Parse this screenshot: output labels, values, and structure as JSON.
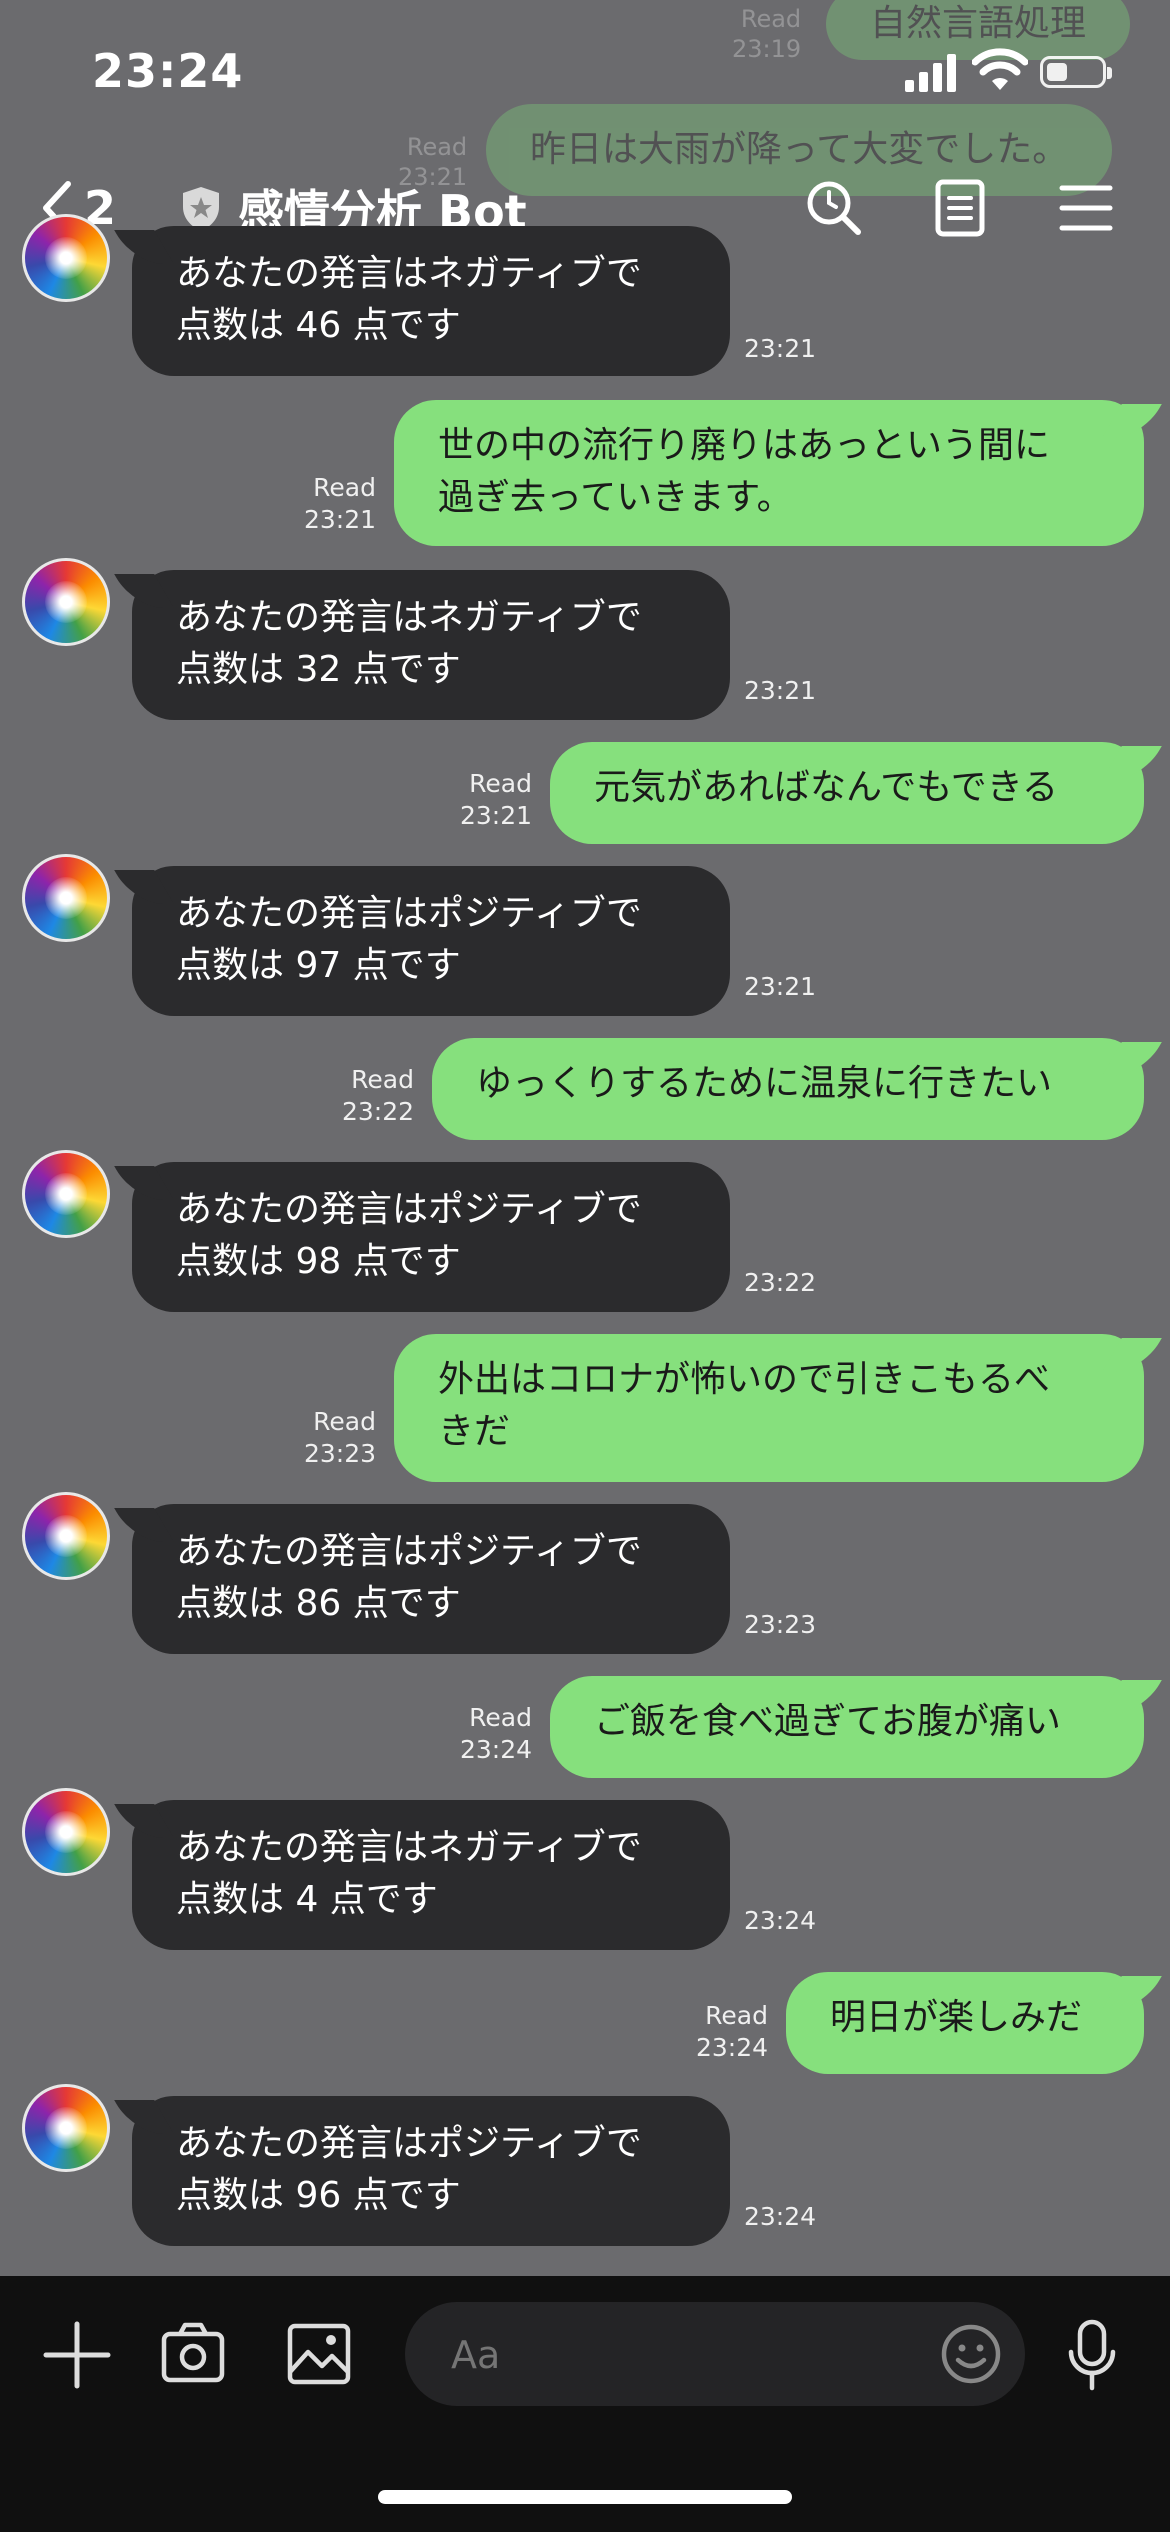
{
  "status": {
    "time": "23:24"
  },
  "header": {
    "back_count": "2",
    "title": "感情分析 Bot"
  },
  "ghost": [
    {
      "meta_read": "Read",
      "meta_time": "23:19",
      "text": "自然言語処理"
    },
    {
      "meta_read": "Read",
      "meta_time": "23:21",
      "text": "昨日は大雨が降って大変でした。"
    }
  ],
  "messages": [
    {
      "from": "bot",
      "line1": "あなたの発言はネガティブで",
      "line2": "点数は 46 点です",
      "time": "23:21"
    },
    {
      "from": "user",
      "line1": "世の中の流行り廃りはあっという間に",
      "line2": "過ぎ去っていきます。",
      "read": "Read",
      "time": "23:21"
    },
    {
      "from": "bot",
      "line1": "あなたの発言はネガティブで",
      "line2": "点数は 32 点です",
      "time": "23:21"
    },
    {
      "from": "user",
      "line1": "元気があればなんでもできる",
      "read": "Read",
      "time": "23:21"
    },
    {
      "from": "bot",
      "line1": "あなたの発言はポジティブで",
      "line2": "点数は 97 点です",
      "time": "23:21"
    },
    {
      "from": "user",
      "line1": "ゆっくりするために温泉に行きたい",
      "read": "Read",
      "time": "23:22"
    },
    {
      "from": "bot",
      "line1": "あなたの発言はポジティブで",
      "line2": "点数は 98 点です",
      "time": "23:22"
    },
    {
      "from": "user",
      "line1": "外出はコロナが怖いので引きこもるべ",
      "line2": "きだ",
      "read": "Read",
      "time": "23:23"
    },
    {
      "from": "bot",
      "line1": "あなたの発言はポジティブで",
      "line2": "点数は 86 点です",
      "time": "23:23"
    },
    {
      "from": "user",
      "line1": "ご飯を食べ過ぎてお腹が痛い",
      "read": "Read",
      "time": "23:24"
    },
    {
      "from": "bot",
      "line1": "あなたの発言はネガティブで",
      "line2": "点数は 4 点です",
      "time": "23:24"
    },
    {
      "from": "user",
      "line1": "明日が楽しみだ",
      "read": "Read",
      "time": "23:24"
    },
    {
      "from": "bot",
      "line1": "あなたの発言はポジティブで",
      "line2": "点数は 96 点です",
      "time": "23:24"
    }
  ],
  "input": {
    "placeholder": "Aa"
  },
  "icons": {
    "back": "chevron-left-icon",
    "shield": "shield-icon",
    "search": "search-icon",
    "notes": "notes-icon",
    "menu": "menu-icon",
    "plus": "plus-icon",
    "camera": "camera-icon",
    "image": "image-icon",
    "emoji": "emoji-icon",
    "mic": "mic-icon"
  },
  "colors": {
    "background": "#6b6b6e",
    "user_bubble": "#86e07d",
    "bot_bubble": "#2b2b2d",
    "bottom_bar": "#101010"
  }
}
